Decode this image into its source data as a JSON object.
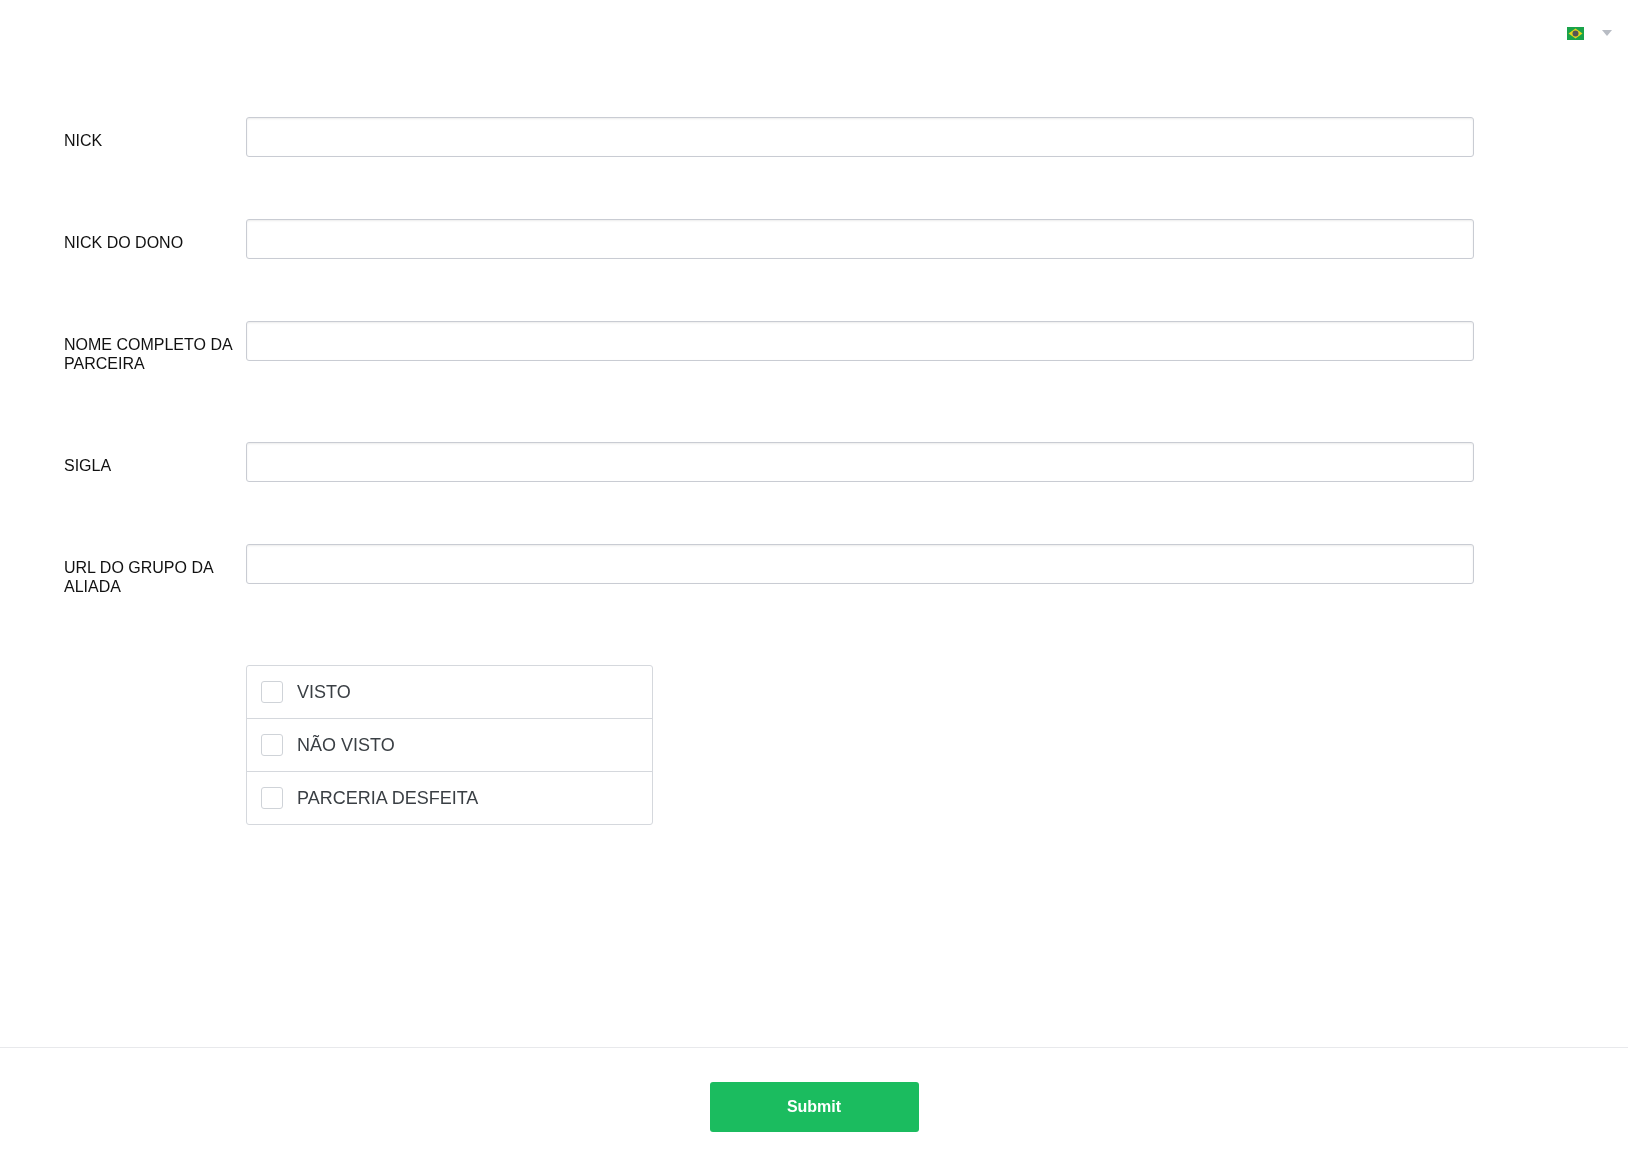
{
  "fields": [
    {
      "label": "NICK"
    },
    {
      "label": "NICK DO DONO"
    },
    {
      "label": "NOME COMPLETO DA PARCEIRA"
    },
    {
      "label": "SIGLA"
    },
    {
      "label": "URL DO GRUPO DA ALIADA"
    }
  ],
  "options": [
    {
      "label": "VISTO",
      "checked": false
    },
    {
      "label": "NÃO VISTO",
      "checked": false
    },
    {
      "label": "PARCERIA DESFEITA",
      "checked": false
    }
  ],
  "submit": {
    "label": "Submit"
  }
}
